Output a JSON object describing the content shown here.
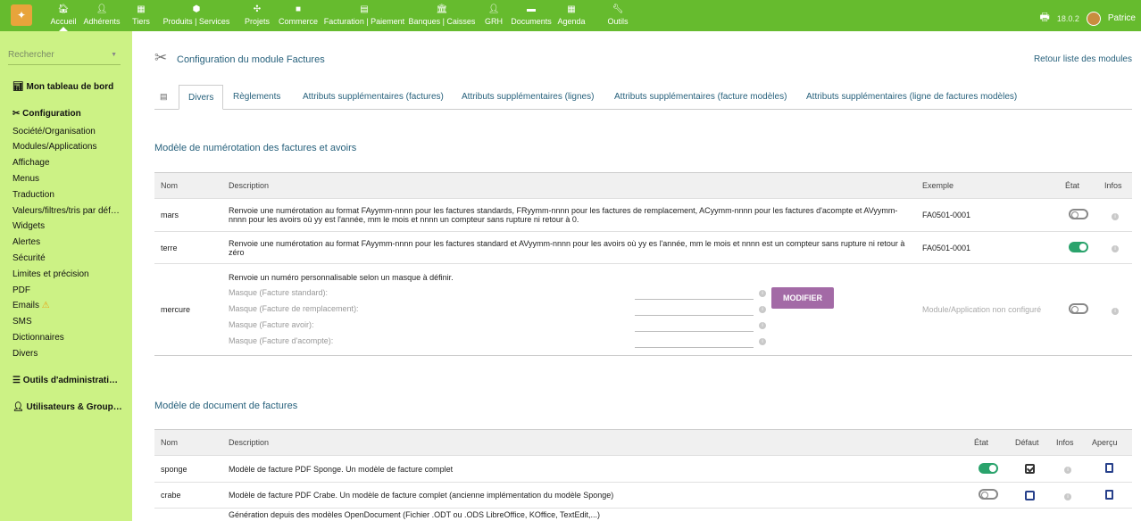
{
  "topbar": {
    "menu": [
      {
        "label": "Accueil",
        "icon": "home-icon",
        "glyph": "🏠︎"
      },
      {
        "label": "Adhérents",
        "icon": "person-icon",
        "glyph": "👤︎"
      },
      {
        "label": "Tiers",
        "icon": "building-icon",
        "glyph": "▦"
      },
      {
        "label": "Produits | Services",
        "icon": "cube-icon",
        "glyph": "⬢"
      },
      {
        "label": "Projets",
        "icon": "project-icon",
        "glyph": "✣"
      },
      {
        "label": "Commerce",
        "icon": "briefcase-icon",
        "glyph": "■"
      },
      {
        "label": "Facturation | Paiement",
        "icon": "invoice-icon",
        "glyph": "▤"
      },
      {
        "label": "Banques | Caisses",
        "icon": "bank-icon",
        "glyph": "🏛︎"
      },
      {
        "label": "GRH",
        "icon": "hr-icon",
        "glyph": "👤︎"
      },
      {
        "label": "Documents",
        "icon": "folder-icon",
        "glyph": "▬"
      },
      {
        "label": "Agenda",
        "icon": "calendar-icon",
        "glyph": "▦"
      },
      {
        "label": "Outils",
        "icon": "wrench-icon",
        "glyph": "🔧︎"
      }
    ],
    "version": "18.0.2",
    "user": "Patrice"
  },
  "sidebar": {
    "search_placeholder": "Rechercher",
    "dashboard": "Mon tableau de bord",
    "configuration": "Configuration",
    "items": [
      "Société/Organisation",
      "Modules/Applications",
      "Affichage",
      "Menus",
      "Traduction",
      "Valeurs/filtres/tris par déf…",
      "Widgets",
      "Alertes",
      "Sécurité",
      "Limites et précision",
      "PDF",
      "Emails",
      "SMS",
      "Dictionnaires",
      "Divers"
    ],
    "admin_tools": "Outils d'administrati…",
    "users_groups": "Utilisateurs & Group…"
  },
  "main": {
    "title": "Configuration du module Factures",
    "back_link": "Retour liste des modules",
    "tabs": [
      "Divers",
      "Règlements",
      "Attributs supplémentaires (factures)",
      "Attributs supplémentaires (lignes)",
      "Attributs supplémentaires (facture modèles)",
      "Attributs supplémentaires (ligne de factures modèles)"
    ],
    "numbering": {
      "title": "Modèle de numérotation des factures et avoirs",
      "headers": {
        "name": "Nom",
        "description": "Description",
        "example": "Exemple",
        "state": "État",
        "info": "Infos"
      },
      "rows": [
        {
          "name": "mars",
          "description": "Renvoie une numérotation au format FAyymm-nnnn pour les factures standards, FRyymm-nnnn pour les factures de remplacement, ACyymm-nnnn pour les factures d'acompte et AVyymm-nnnn pour les avoirs où yy est l'année, mm le mois et nnnn un compteur sans rupture ni retour à 0.",
          "example": "FA0501-0001",
          "enabled": false
        },
        {
          "name": "terre",
          "description": "Renvoie une numérotation au format FAyymm-nnnn pour les factures standard et AVyymm-nnnn pour les avoirs où yy es l'année, mm le mois et nnnn est un compteur sans rupture ni retour à zéro",
          "example": "FA0501-0001",
          "enabled": true
        }
      ],
      "mercure": {
        "name": "mercure",
        "description": "Renvoie un numéro personnalisable selon un masque à définir.",
        "masks": [
          "Masque (Facture standard):",
          "Masque (Facture de remplacement):",
          "Masque (Facture avoir):",
          "Masque (Facture d'acompte):"
        ],
        "button": "MODIFIER",
        "example": "Module/Application non configuré",
        "enabled": false
      }
    },
    "documents": {
      "title": "Modèle de document de factures",
      "headers": {
        "name": "Nom",
        "description": "Description",
        "state": "État",
        "default": "Défaut",
        "info": "Infos",
        "preview": "Aperçu"
      },
      "rows": [
        {
          "name": "sponge",
          "description": "Modèle de facture PDF Sponge. Un modèle de facture complet",
          "enabled": true,
          "default": true
        },
        {
          "name": "crabe",
          "description": "Modèle de facture PDF Crabe. Un modèle de facture complet (ancienne implémentation du modèle Sponge)",
          "enabled": false,
          "default": false
        }
      ],
      "partial_row": "Génération depuis des modèles OpenDocument (Fichier .ODT ou .ODS LibreOffice, KOffice, TextEdit,...)"
    }
  }
}
